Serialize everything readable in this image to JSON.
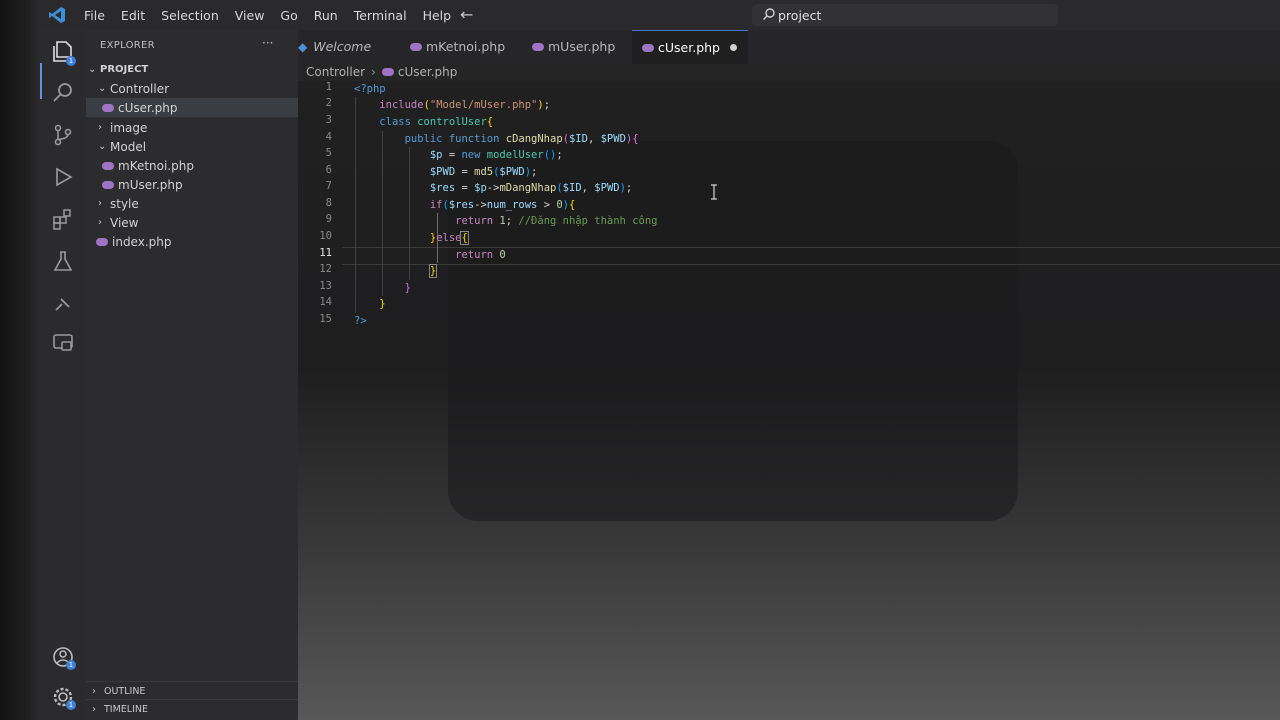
{
  "menu": [
    "File",
    "Edit",
    "Selection",
    "View",
    "Go",
    "Run",
    "Terminal",
    "Help"
  ],
  "command_center": {
    "text": "project"
  },
  "sidebar": {
    "header": "EXPLORER",
    "project": "PROJECT",
    "tree": [
      {
        "label": "Controller",
        "type": "folder-open"
      },
      {
        "label": "cUser.php",
        "type": "file",
        "selected": true
      },
      {
        "label": "image",
        "type": "folder-closed"
      },
      {
        "label": "Model",
        "type": "folder-open"
      },
      {
        "label": "mKetnoi.php",
        "type": "file"
      },
      {
        "label": "mUser.php",
        "type": "file"
      },
      {
        "label": "style",
        "type": "folder-closed"
      },
      {
        "label": "View",
        "type": "folder-closed"
      },
      {
        "label": "index.php",
        "type": "file"
      }
    ],
    "footer": [
      "OUTLINE",
      "TIMELINE"
    ]
  },
  "tabs": [
    {
      "label": "Welcome",
      "icon": "vscode-icon"
    },
    {
      "label": "mKetnoi.php",
      "icon": "php-icon"
    },
    {
      "label": "mUser.php",
      "icon": "php-icon"
    },
    {
      "label": "cUser.php",
      "icon": "php-icon",
      "active": true,
      "unsaved": true
    }
  ],
  "breadcrumb": [
    "Controller",
    "cUser.php"
  ],
  "editor": {
    "line_numbers": [
      "1",
      "2",
      "3",
      "4",
      "5",
      "6",
      "7",
      "8",
      "9",
      "10",
      "11",
      "12",
      "13",
      "14",
      "15"
    ],
    "current_line": "11",
    "code": {
      "l1_open": "<?php",
      "l2_include": "include",
      "l2_path": "\"Model/mUser.php\"",
      "l3_class_kw": "class",
      "l3_class_name": "controlUser",
      "l4_public": "public",
      "l4_function": "function",
      "l4_fn_name": "cDangNhap",
      "l4_p1": "$ID",
      "l4_p2": "$PWD",
      "l5_var": "$p",
      "l5_new": "new",
      "l5_cls": "modelUser",
      "l6_var": "$PWD",
      "l6_fn": "md5",
      "l6_arg": "$PWD",
      "l7_var": "$res",
      "l7_obj": "$p",
      "l7_method": "mDangNhap",
      "l7_a1": "$ID",
      "l7_a2": "$PWD",
      "l8_if": "if",
      "l8_var": "$res",
      "l8_prop": "num_rows",
      "l8_num": "0",
      "l9_return": "return",
      "l9_num": "1",
      "l9_comment": "//Đăng nhập thành công",
      "l10_else": "else",
      "l11_return": "return",
      "l11_num": "0",
      "l15_close": "?>"
    }
  },
  "activity_bar": [
    "explorer-icon",
    "search-icon",
    "source-control-icon",
    "run-debug-icon",
    "extensions-icon",
    "testing-icon",
    "remote-icon",
    "remote-explorer-icon",
    "account-icon",
    "settings-gear-icon"
  ],
  "colors": {
    "accent": "#4d78cc",
    "badge": "#3d7fd9",
    "php": "#a074c4"
  }
}
